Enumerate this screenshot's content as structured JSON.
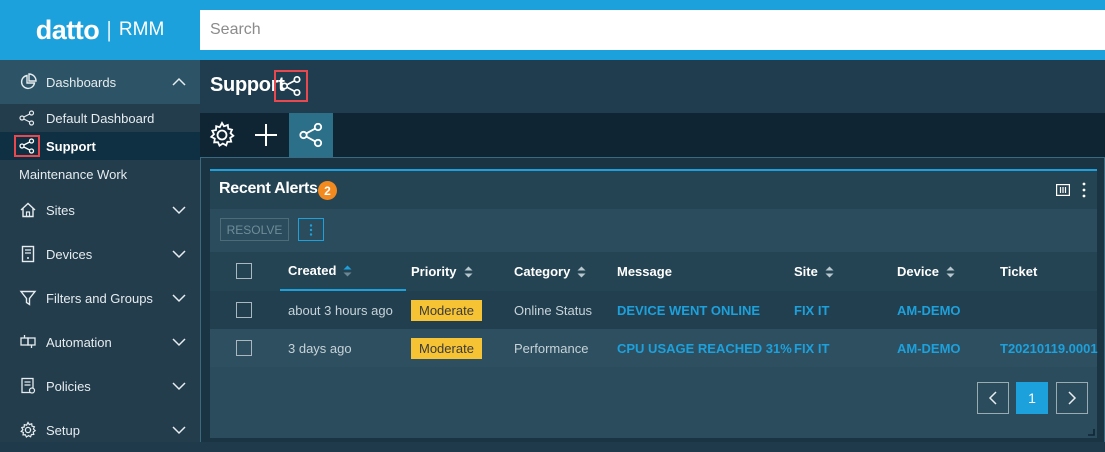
{
  "brand": {
    "name": "datto",
    "separator": "|",
    "product": "RMM"
  },
  "search": {
    "placeholder": "Search",
    "value": ""
  },
  "sidebar": {
    "dashboards": {
      "label": "Dashboards",
      "expanded": true
    },
    "dashboard_items": [
      {
        "label": "Default Dashboard",
        "icon": "share-icon",
        "selected": false
      },
      {
        "label": "Support",
        "icon": "share-icon",
        "selected": true
      }
    ],
    "maintenance": "Maintenance Work",
    "sections": [
      {
        "label": "Sites",
        "icon": "home-icon"
      },
      {
        "label": "Devices",
        "icon": "server-icon"
      },
      {
        "label": "Filters and Groups",
        "icon": "filter-icon"
      },
      {
        "label": "Automation",
        "icon": "automation-icon"
      },
      {
        "label": "Policies",
        "icon": "policy-icon"
      },
      {
        "label": "Setup",
        "icon": "gear-icon"
      }
    ]
  },
  "page": {
    "title": "Support"
  },
  "toolbar": {
    "buttons": [
      "gear-icon",
      "plus-icon",
      "share-icon"
    ],
    "active": "share-icon"
  },
  "widget": {
    "title": "Recent Alerts",
    "badge": "2",
    "resolve_label": "RESOLVE",
    "columns": [
      "Created",
      "Priority",
      "Category",
      "Message",
      "Site",
      "Device",
      "Ticket"
    ],
    "sorted_column": "Created",
    "rows": [
      {
        "created": "about 3 hours ago",
        "priority": "Moderate",
        "category": "Online Status",
        "message": "DEVICE WENT ONLINE",
        "site": "FIX IT",
        "device": "AM-DEMO",
        "ticket": ""
      },
      {
        "created": "3 days ago",
        "priority": "Moderate",
        "category": "Performance",
        "message": "CPU USAGE REACHED 31%",
        "site": "FIX IT",
        "device": "AM-DEMO",
        "ticket": "T20210119.0001"
      }
    ],
    "pagination": {
      "current": "1"
    }
  },
  "colors": {
    "accent": "#1da1dc",
    "highlight": "#e8484e",
    "badge": "#f28a1f",
    "priority": "#f5c333"
  }
}
